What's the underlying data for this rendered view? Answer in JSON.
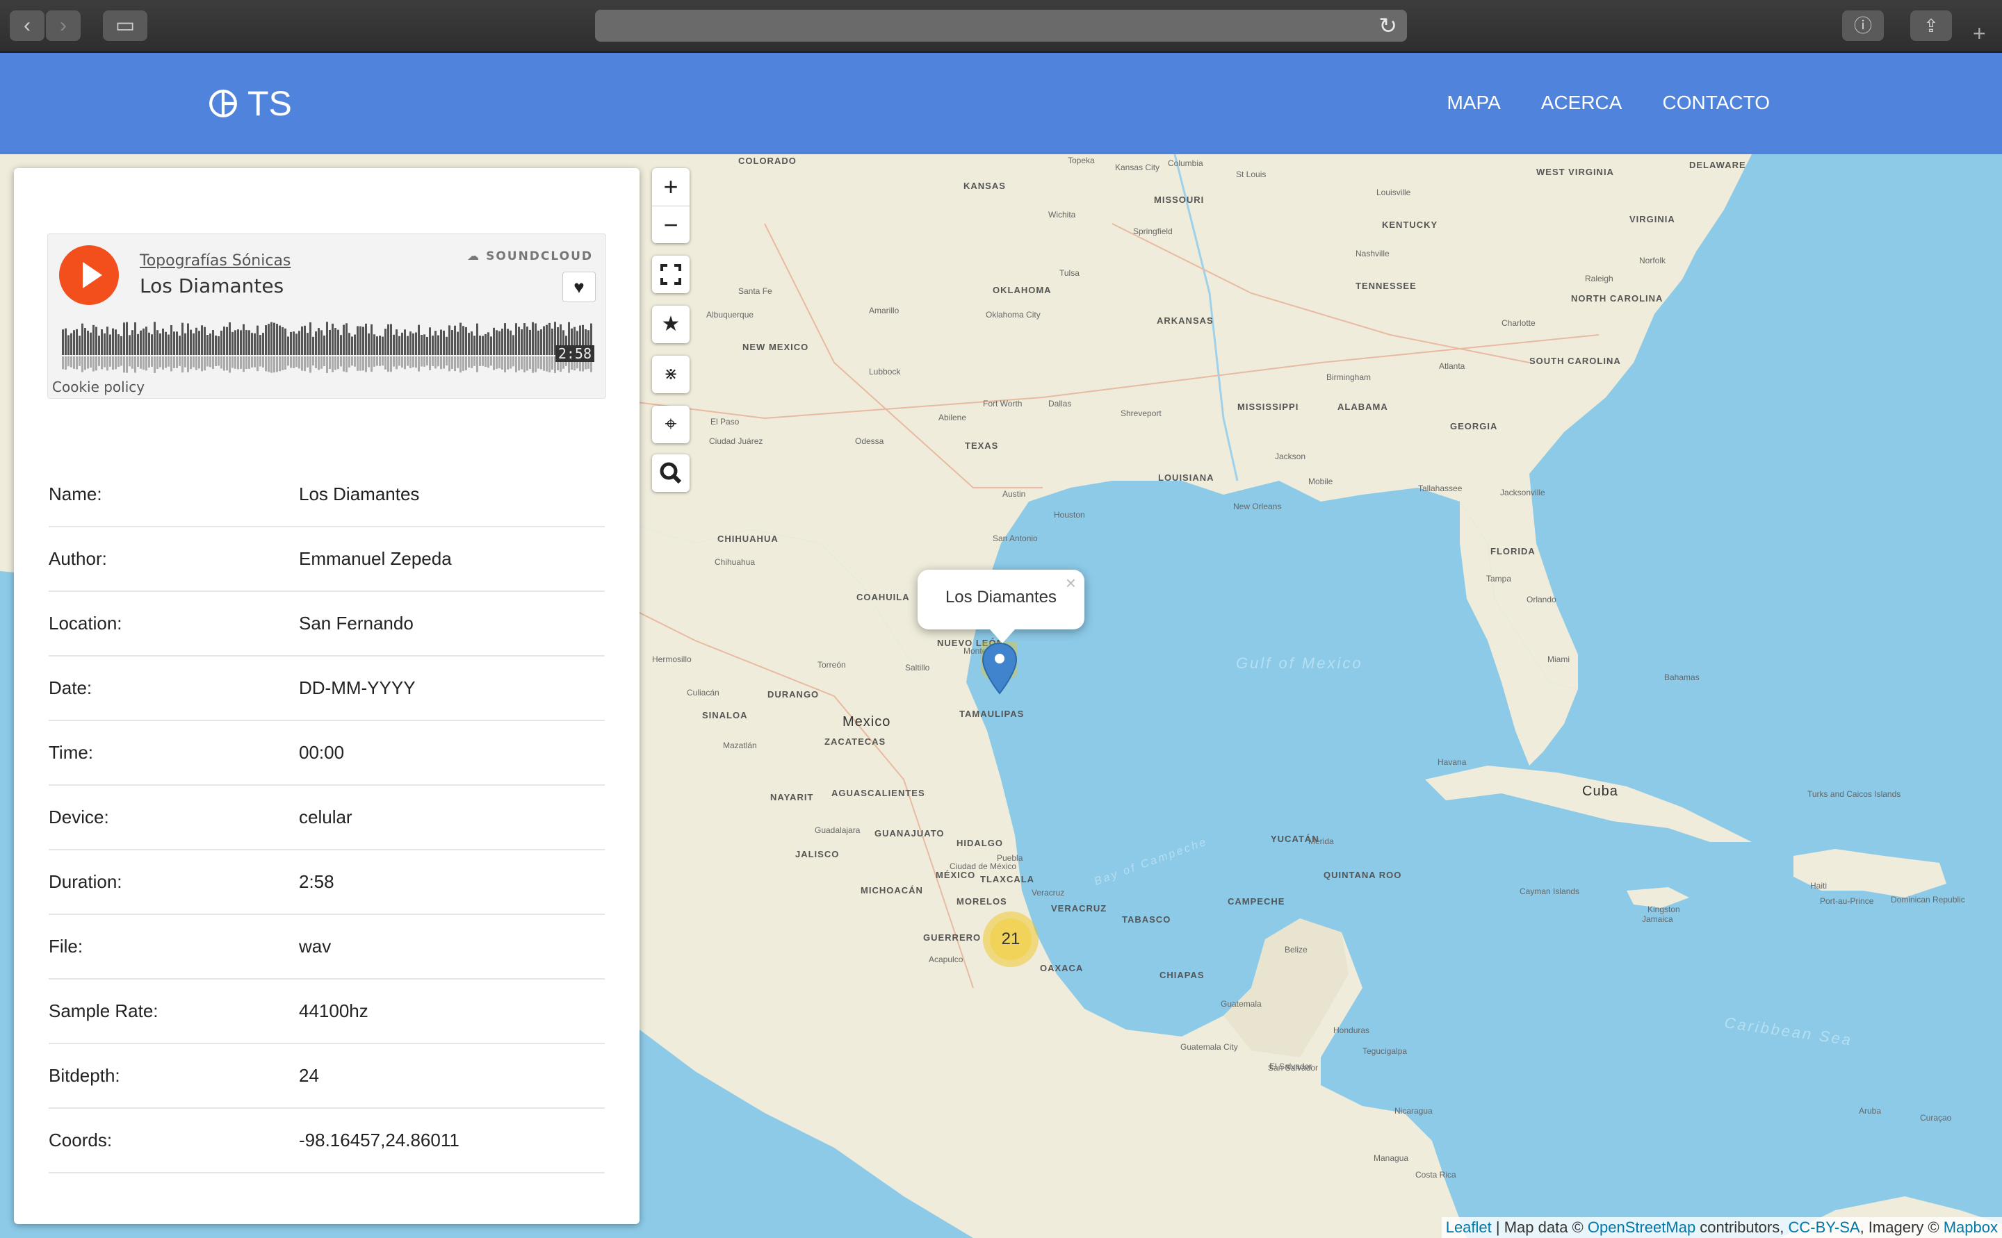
{
  "browser": {
    "url": ""
  },
  "header": {
    "logo_text": "TS",
    "nav": [
      "MAPA",
      "ACERCA",
      "CONTACTO"
    ]
  },
  "player": {
    "artist": "Topografías Sónicas",
    "track": "Los Diamantes",
    "brand": "SOUNDCLOUD",
    "duration": "2:58",
    "cookie_policy": "Cookie policy"
  },
  "info": [
    {
      "label": "Name:",
      "value": "Los Diamantes"
    },
    {
      "label": "Author:",
      "value": "Emmanuel Zepeda"
    },
    {
      "label": "Location:",
      "value": "San Fernando"
    },
    {
      "label": "Date:",
      "value": "DD-MM-YYYY"
    },
    {
      "label": "Time:",
      "value": "00:00"
    },
    {
      "label": "Device:",
      "value": "celular"
    },
    {
      "label": "Duration:",
      "value": "2:58"
    },
    {
      "label": "File:",
      "value": "wav"
    },
    {
      "label": "Sample Rate:",
      "value": "44100hz"
    },
    {
      "label": "Bitdepth:",
      "value": "24"
    },
    {
      "label": "Coords:",
      "value": "-98.16457,24.86011"
    }
  ],
  "map": {
    "zoom_in": "+",
    "zoom_out": "−",
    "popup_title": "Los Diamantes",
    "popup_close": "×",
    "cluster_count": "21",
    "sea_labels": [
      "Gulf of Mexico",
      "Caribbean Sea",
      "Bay of Campeche"
    ],
    "region_labels": [
      "COLORADO",
      "KANSAS",
      "MISSOURI",
      "KENTUCKY",
      "VIRGINIA",
      "WEST VIRGINIA",
      "DELAWARE",
      "OKLAHOMA",
      "ARKANSAS",
      "TENNESSEE",
      "NORTH CAROLINA",
      "SOUTH CAROLINA",
      "NEW MEXICO",
      "TEXAS",
      "MISSISSIPPI",
      "ALABAMA",
      "GEORGIA",
      "LOUISIANA",
      "FLORIDA",
      "CHIHUAHUA",
      "COAHUILA",
      "NUEVO LEÓN",
      "TAMAULIPAS",
      "DURANGO",
      "SINALOA",
      "ZACATECAS",
      "NAYARIT",
      "AGUASCALIENTES",
      "JALISCO",
      "GUANAJUATO",
      "HIDALGO",
      "MICHOACÁN",
      "MÉXICO",
      "TLAXCALA",
      "GUERRERO",
      "MORELOS",
      "VERACRUZ",
      "OAXACA",
      "TABASCO",
      "CHIAPAS",
      "CAMPECHE",
      "YUCATÁN",
      "QUINTANA ROO"
    ],
    "place_labels": [
      "Mexico",
      "Cuba",
      "Bahamas",
      "Belize",
      "Guatemala",
      "Honduras",
      "El Salvador",
      "Nicaragua",
      "Costa Rica",
      "Jamaica",
      "Haiti",
      "Dominican Republic",
      "Cayman Islands",
      "Turks and Caicos Islands",
      "Aruba",
      "Curaçao"
    ],
    "city_labels": [
      "Topeka",
      "Kansas City",
      "Columbia",
      "St Louis",
      "Louisville",
      "Wichita",
      "Springfield",
      "Nashville",
      "Tulsa",
      "Oklahoma City",
      "Amarillo",
      "Albuquerque",
      "Santa Fe",
      "Lubbock",
      "Dallas",
      "Fort Worth",
      "Shreveport",
      "Jackson",
      "Birmingham",
      "Atlanta",
      "Charlotte",
      "Raleigh",
      "Norfolk",
      "Abilene",
      "Odessa",
      "El Paso",
      "Ciudad Juárez",
      "Austin",
      "San Antonio",
      "Houston",
      "New Orleans",
      "Mobile",
      "Tallahassee",
      "Jacksonville",
      "Orlando",
      "Tampa",
      "Miami",
      "Monterrey",
      "Saltillo",
      "Torreón",
      "Culiacán",
      "Mazatlán",
      "Guadalajara",
      "Ciudad de México",
      "Puebla",
      "Acapulco",
      "Veracruz",
      "Mérida",
      "Havana",
      "Kingston",
      "Port-au-Prince",
      "Managua",
      "Tegucigalpa",
      "San Salvador",
      "Guatemala City",
      "Chihuahua",
      "Hermosillo"
    ],
    "attribution": {
      "leaflet": "Leaflet",
      "text1": " | Map data © ",
      "osm": "OpenStreetMap",
      "text2": " contributors, ",
      "license": "CC-BY-SA",
      "text3": ", Imagery © ",
      "mapbox": "Mapbox"
    }
  },
  "colors": {
    "header": "#5083dc",
    "sea": "#8ccae8",
    "land": "#efecdb",
    "soundcloud": "#f24f1c"
  }
}
